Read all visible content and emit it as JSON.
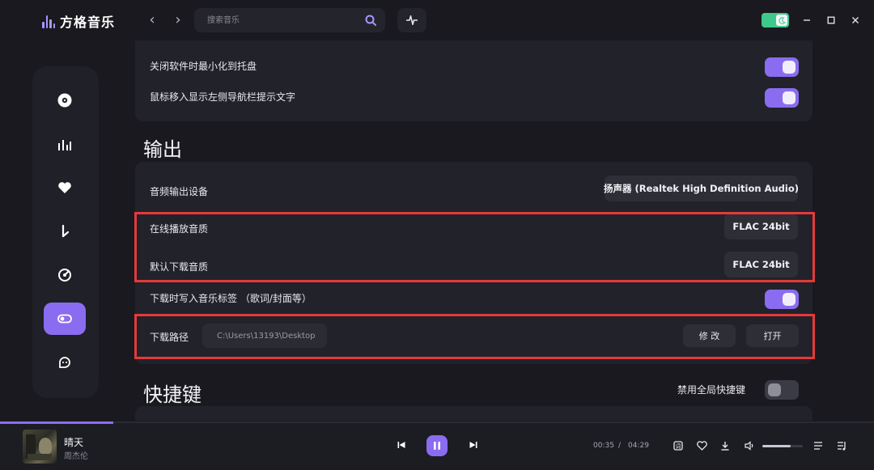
{
  "app": {
    "name": "方格音乐"
  },
  "search": {
    "placeholder": "搜索音乐"
  },
  "general": {
    "rows": [
      {
        "label": "关闭软件时最小化到托盘",
        "enabled": true
      },
      {
        "label": "鼠标移入显示左侧导航栏提示文字",
        "enabled": true
      }
    ]
  },
  "output": {
    "title": "输出",
    "device_label": "音频输出设备",
    "device_value": "扬声器 (Realtek High Definition Audio)",
    "online_quality_label": "在线播放音质",
    "online_quality_value": "FLAC 24bit",
    "download_quality_label": "默认下载音质",
    "download_quality_value": "FLAC 24bit",
    "write_tags_label": "下载时写入音乐标签 （歌词/封面等）",
    "write_tags_enabled": true,
    "download_path_label": "下载路径",
    "download_path_value": "C:\\Users\\13193\\Desktop",
    "modify_label": "修 改",
    "open_label": "打开"
  },
  "shortcuts": {
    "title": "快捷键",
    "disable_global_label": "禁用全局快捷键",
    "disable_global_enabled": false
  },
  "player": {
    "song_title": "晴天",
    "artist": "周杰伦",
    "current_time": "00:35",
    "separator": "/",
    "total_time": "04:29",
    "progress": 0.13,
    "volume": 0.7
  },
  "colors": {
    "accent": "#8a6cf0",
    "highlight_border": "#e5393b",
    "theme_toggle": "#3ec98a"
  },
  "icons": [
    "logo-wave-icon",
    "back-arrow-icon",
    "forward-arrow-icon",
    "search-icon",
    "waveform-icon",
    "moon-icon",
    "minimize-icon",
    "maximize-icon",
    "close-icon",
    "disc-icon",
    "chart-bars-icon",
    "heart-icon",
    "download-arrow-icon",
    "gauge-icon",
    "toggle-icon",
    "chat-icon",
    "prev-icon",
    "pause-icon",
    "next-icon",
    "lyrics-icon",
    "like-icon",
    "download-icon",
    "volume-icon",
    "playlist-icon",
    "queue-icon"
  ]
}
